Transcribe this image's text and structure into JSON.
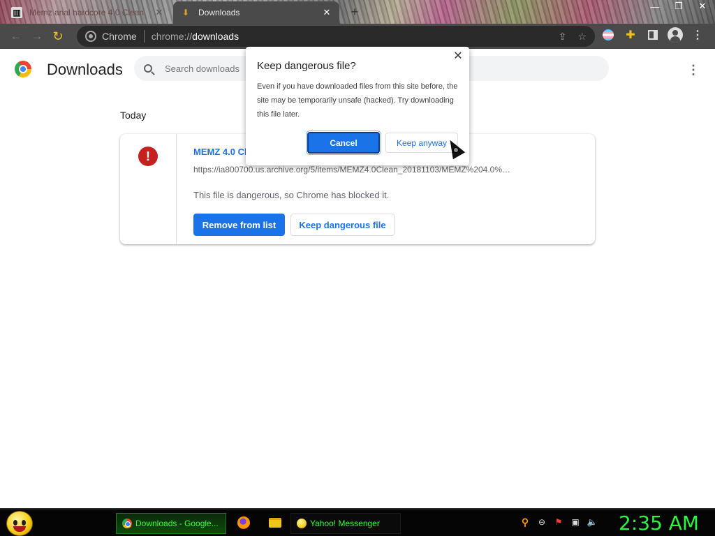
{
  "browser": {
    "tabs": [
      {
        "title": "Memz anal hardcore 4.0 Clean",
        "active": false
      },
      {
        "title": "Downloads",
        "active": true
      }
    ],
    "omnibox": {
      "chip": "Chrome",
      "url_scheme": "chrome://",
      "url_host": "downloads"
    }
  },
  "page": {
    "title": "Downloads",
    "search_placeholder": "Search downloads",
    "group_label": "Today",
    "item": {
      "file_name": "MEMZ 4.0 Cl",
      "url": "https://ia800700.us.archive.org/5/items/MEMZ4.0Clean_20181103/MEMZ%204.0%…",
      "status": "This file is dangerous, so Chrome has blocked it.",
      "remove_label": "Remove from list",
      "keep_label": "Keep dangerous file"
    }
  },
  "dialog": {
    "title": "Keep dangerous file?",
    "body": "Even if you have downloaded files from this site before, the site may be temporarily unsafe (hacked). Try downloading this file later.",
    "cancel_label": "Cancel",
    "keep_label": "Keep anyway"
  },
  "taskbar": {
    "tasks": [
      {
        "label": "Downloads - Google..."
      },
      {
        "label": "Yahoo! Messenger"
      }
    ],
    "clock": "2:35 AM"
  },
  "colors": {
    "accent": "#1a73e8",
    "danger": "#c5221f",
    "clock": "#27f53f"
  }
}
